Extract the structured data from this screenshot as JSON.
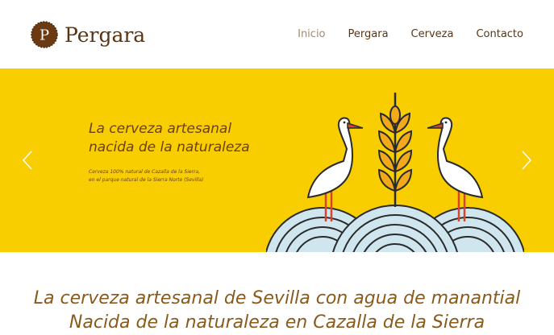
{
  "header": {
    "logo_letter": "P",
    "brand": "Pergara",
    "nav": [
      {
        "label": "Inicio",
        "active": true
      },
      {
        "label": "Pergara",
        "active": false
      },
      {
        "label": "Cerveza",
        "active": false
      },
      {
        "label": "Contacto",
        "active": false
      }
    ]
  },
  "hero": {
    "title_line1": "La cerveza artesanal",
    "title_line2": "nacida de la naturaleza",
    "subtitle_line1": "Cerveza 100% natural de Cazalla de la Sierra,",
    "subtitle_line2": "en el parque natural de la Sierra Norte (Sevilla)"
  },
  "tagline": {
    "line1": "La cerveza artesanal de Sevilla con agua de manantial",
    "line2": "Nacida de la naturaleza en Cazalla de la Sierra"
  },
  "colors": {
    "hero_bg": "#f9ce00",
    "brand_brown": "#5a3410",
    "tagline_brown": "#8a5a1c",
    "water_blue": "#cfe6ef"
  }
}
